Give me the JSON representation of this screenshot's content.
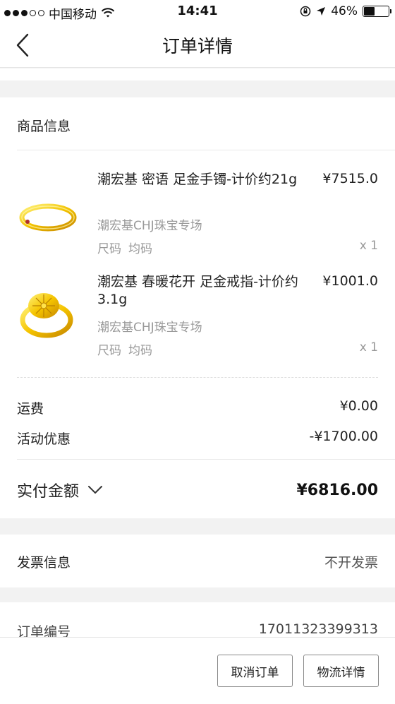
{
  "status_bar": {
    "carrier": "中国移动",
    "time": "14:41",
    "battery": "46%",
    "battery_level": 0.46
  },
  "nav": {
    "title": "订单详情"
  },
  "goods": {
    "section_title": "商品信息",
    "items": [
      {
        "name": "潮宏基 密语 足金手镯-计价约21g",
        "price": "¥7515.0",
        "shop": "潮宏基CHJ珠宝专场",
        "size_label": "尺码",
        "size_value": "均码",
        "qty": "x 1",
        "image_icon": "gold-bangle-image"
      },
      {
        "name": "潮宏基 春暖花开 足金戒指-计价约3.1g",
        "price": "¥1001.0",
        "shop": "潮宏基CHJ珠宝专场",
        "size_label": "尺码",
        "size_value": "均码",
        "qty": "x 1",
        "image_icon": "gold-ring-image"
      }
    ]
  },
  "costs": {
    "shipping_label": "运费",
    "shipping_value": "¥0.00",
    "discount_label": "活动优惠",
    "discount_value": "-¥1700.00",
    "total_label": "实付金额",
    "total_value": "¥6816.00"
  },
  "invoice": {
    "label": "发票信息",
    "value": "不开发票"
  },
  "order": {
    "number_label": "订单编号",
    "number_value": "17011323399313"
  },
  "footer": {
    "cancel_label": "取消订单",
    "logistics_label": "物流详情"
  }
}
